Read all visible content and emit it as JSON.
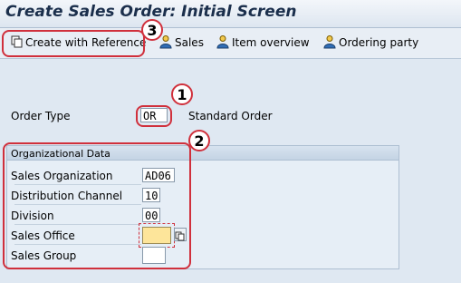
{
  "window": {
    "title": "Create Sales Order: Initial Screen"
  },
  "toolbar": {
    "create_with_reference": "Create with Reference",
    "sales": "Sales",
    "item_overview": "Item overview",
    "ordering_party": "Ordering party"
  },
  "header": {
    "order_type_label": "Order Type",
    "order_type_value": "OR",
    "order_type_desc": "Standard Order"
  },
  "org_data": {
    "title": "Organizational Data",
    "sales_org_label": "Sales Organization",
    "sales_org_value": "AD06",
    "dist_channel_label": "Distribution Channel",
    "dist_channel_value": "10",
    "division_label": "Division",
    "division_value": "00",
    "sales_office_label": "Sales Office",
    "sales_office_value": "",
    "sales_group_label": "Sales Group",
    "sales_group_value": ""
  },
  "annotations": {
    "n1": "1",
    "n2": "2",
    "n3": "3"
  },
  "colors": {
    "annotation": "#d0303c",
    "focused_field": "#fde59a"
  }
}
